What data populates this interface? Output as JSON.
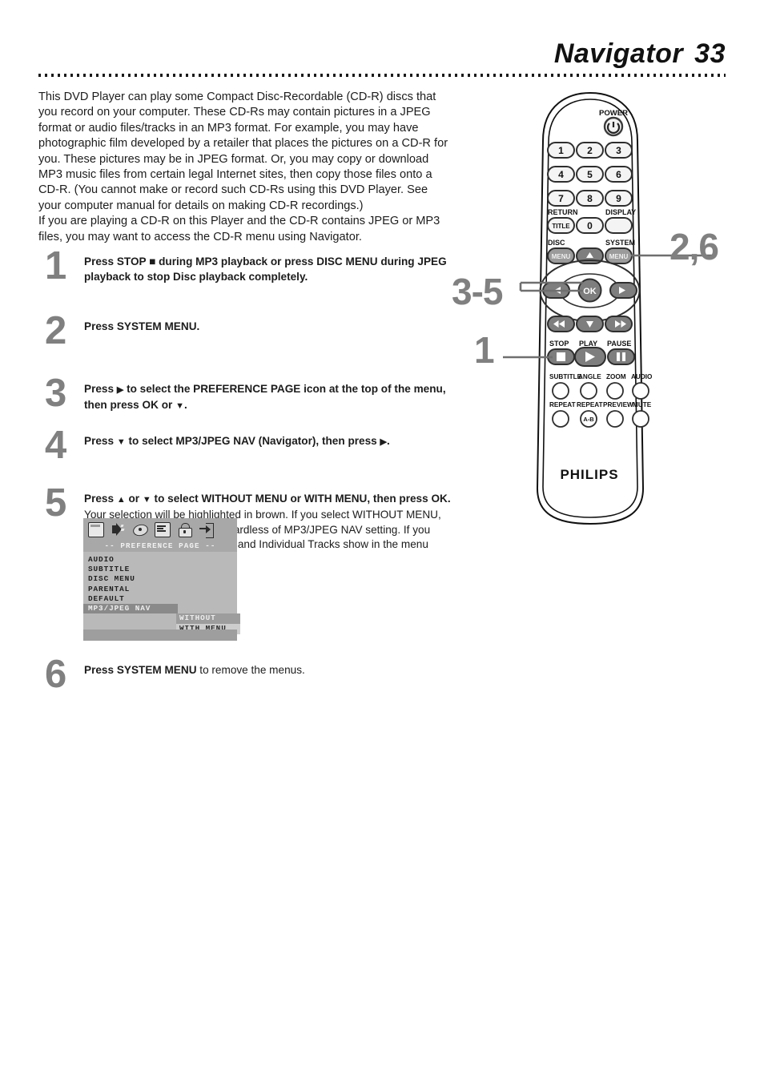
{
  "header": {
    "title": "Navigator",
    "page_number": "33"
  },
  "intro": {
    "paragraph_1": "This DVD Player can play some Compact Disc-Recordable (CD-R) discs that you record on your computer. These CD-Rs may contain pictures in a JPEG format or audio files/tracks in an MP3 format. For example, you may have photographic film developed by a retailer that places the pictures on a CD-R for you. These pictures may be in JPEG format. Or, you may copy or download MP3 music files from certain legal Internet sites, then copy those files onto a CD-R.  (You cannot make or record such CD-Rs using this DVD Player. See your computer manual for details on making CD-R recordings.)",
    "paragraph_2": "If you are playing a CD-R on this Player and the CD-R contains JPEG or MP3 files, you may want to access the CD-R menu using Navigator."
  },
  "steps": [
    {
      "number": "1",
      "text_html": "<b>Press STOP ■ during MP3 playback or press DISC MENU during JPEG playback to stop Disc playback completely.</b>"
    },
    {
      "number": "2",
      "text_html": "<b>Press SYSTEM MENU.</b>"
    },
    {
      "number": "3",
      "text_html": "<b>Press <span class=\"arr\">▶</span> to select the PREFERENCE PAGE icon at the top of the menu, then press OK or <span class=\"arr\">▼</span>.</b>"
    },
    {
      "number": "4",
      "text_html": "<b>Press <span class=\"arr\">▼</span> to select MP3/JPEG NAV (Navigator), then press <span class=\"arr\">▶</span>.</b>"
    },
    {
      "number": "5",
      "text_html": "<b>Press <span class=\"arr\">▲</span> or <span class=\"arr\">▼</span> to select WITHOUT MENU or WITH MENU, then press OK.</b>&nbsp; Your selection will be highlighted in brown. If you select WITHOUT MENU, Tracks play in order (1-2-3) regardless of MP3/JPEG NAV setting. If you select WITH MENU,  all Folders and Individual Tracks show in the menu when play is stopped."
    },
    {
      "number": "6",
      "text_html": "<b>Press SYSTEM MENU</b> to remove the menus."
    }
  ],
  "osd": {
    "icons": [
      "tv-icon",
      "audio-speaker-icon",
      "disc-icon",
      "preference-monitor-icon",
      "parental-lock-icon",
      "exit-icon"
    ],
    "title": "--  PREFERENCE  PAGE  --",
    "rows": [
      {
        "label": "AUDIO",
        "selected": false
      },
      {
        "label": "SUBTITLE",
        "selected": false
      },
      {
        "label": "DISC MENU",
        "selected": false
      },
      {
        "label": "PARENTAL",
        "selected": false
      },
      {
        "label": "DEFAULT",
        "selected": false
      },
      {
        "label": "MP3/JPEG NAV",
        "selected": true
      }
    ],
    "options": [
      {
        "label": "WITHOUT MENU",
        "state": "highlighted-dark"
      },
      {
        "label": "WITH MENU",
        "state": "highlighted-light"
      }
    ]
  },
  "remote": {
    "brand": "PHILIPS",
    "power_label": "POWER",
    "keypad": [
      "1",
      "2",
      "3",
      "4",
      "5",
      "6",
      "7",
      "8",
      "9"
    ],
    "zero": "0",
    "return_label": "RETURN",
    "title_label": "TITLE",
    "display_label": "DISPLAY",
    "disc_label": "DISC",
    "disc_menu_label": "MENU",
    "system_label": "SYSTEM",
    "system_menu_label": "MENU",
    "ok_label": "OK",
    "stop_label": "STOP",
    "play_label": "PLAY",
    "pause_label": "PAUSE",
    "function_row_1": [
      "SUBTITLE",
      "ANGLE",
      "ZOOM",
      "AUDIO"
    ],
    "function_row_2": [
      "REPEAT",
      "REPEAT",
      "PREVIEW",
      "MUTE"
    ],
    "repeat_ab_label": "A-B",
    "callouts": {
      "system_menu": "2,6",
      "navigation": "3-5",
      "stop": "1"
    }
  },
  "colors": {
    "step_number_gray": "#808080",
    "text_black": "#1c1c1c",
    "osd_background": "#b9b9b9",
    "osd_selected": "#8a8a8a"
  }
}
